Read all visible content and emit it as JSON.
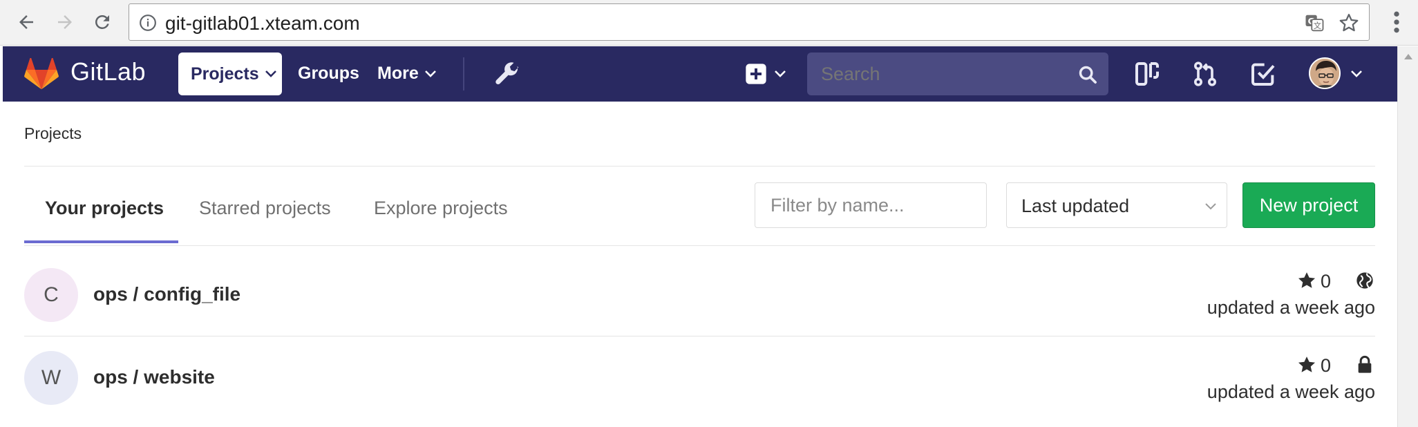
{
  "browser": {
    "url": "git-gitlab01.xteam.com"
  },
  "header": {
    "logo_text": "GitLab",
    "nav": {
      "projects": "Projects",
      "groups": "Groups",
      "more": "More"
    },
    "search_placeholder": "Search"
  },
  "breadcrumb": "Projects",
  "tabs": [
    {
      "label": "Your projects",
      "active": true
    },
    {
      "label": "Starred projects",
      "active": false
    },
    {
      "label": "Explore projects",
      "active": false
    }
  ],
  "filter": {
    "placeholder": "Filter by name..."
  },
  "sort": {
    "selected": "Last updated"
  },
  "new_project_label": "New project",
  "projects": [
    {
      "initial": "C",
      "name": "ops / config_file",
      "stars": "0",
      "visibility": "public",
      "updated": "updated a week ago",
      "avatar_color": "#f4e8f5"
    },
    {
      "initial": "W",
      "name": "ops / website",
      "stars": "0",
      "visibility": "private",
      "updated": "updated a week ago",
      "avatar_color": "#e8eaf6"
    }
  ],
  "colors": {
    "header_bg": "#292961",
    "accent": "#6b6bd1",
    "new_project": "#1aaa55"
  }
}
